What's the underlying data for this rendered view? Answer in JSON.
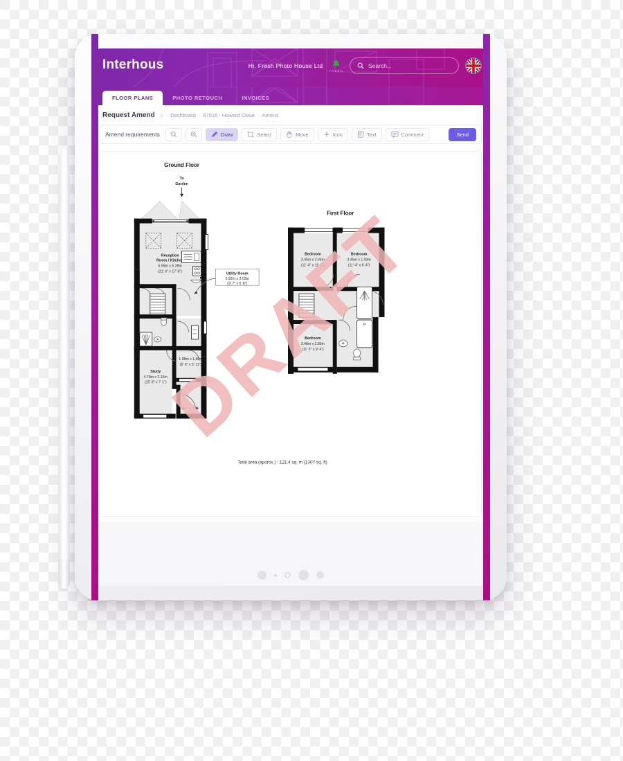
{
  "brand": {
    "name": "Interhous"
  },
  "header": {
    "greeting": "Hi,  Fresh Photo House Ltd",
    "partner_logo_text": "FRESH",
    "search_placeholder": "Search...",
    "flag_label": "uk-flag-icon"
  },
  "tabs": [
    {
      "label": "FLOOR PLANS",
      "active": true
    },
    {
      "label": "PHOTO RETOUCH",
      "active": false
    },
    {
      "label": "INVOICES",
      "active": false
    }
  ],
  "breadcrumb": {
    "title": "Request Amend",
    "home_icon": "⌂",
    "items": [
      "Dashboard",
      "87516 - Howard Close",
      "Amend"
    ],
    "separator": "·"
  },
  "toolbar": {
    "label": "Amend requirements",
    "buttons": [
      {
        "name": "zoom-out",
        "label": "",
        "icon": "zoom-out-icon",
        "active": false
      },
      {
        "name": "zoom-in",
        "label": "",
        "icon": "zoom-in-icon",
        "active": false
      },
      {
        "name": "draw",
        "label": "Draw",
        "icon": "pencil-icon",
        "active": true
      },
      {
        "name": "select",
        "label": "Select",
        "icon": "marquee-icon",
        "active": false
      },
      {
        "name": "move",
        "label": "Move",
        "icon": "hand-icon",
        "active": false
      },
      {
        "name": "icon",
        "label": "Icon",
        "icon": "plus-icon",
        "active": false
      },
      {
        "name": "text",
        "label": "Text",
        "icon": "text-icon",
        "active": false
      },
      {
        "name": "comment",
        "label": "Comment",
        "icon": "comment-icon",
        "active": false
      }
    ],
    "send_label": "Send"
  },
  "floorplan": {
    "watermark": "DRAFT",
    "ground": {
      "title": "Ground Floor",
      "to_garden": "To\nGarden",
      "to_garden_line1": "To",
      "to_garden_line2": "Garden",
      "rooms": [
        {
          "name": "Reception\nRoom / Kitchen",
          "name_line1": "Reception",
          "name_line2": "Room / Kitchen",
          "metric": "6.55m x 5.39m",
          "imperial": "(21' 6\" x 17' 8\")"
        },
        {
          "name": "Utility Room",
          "metric": "2.92m x 2.03m",
          "imperial": "(9' 7\" x 6' 8\")"
        },
        {
          "name": "Study",
          "metric": "4.78m x 2.16m",
          "imperial": "(15' 8\" x 7' 1\")"
        },
        {
          "name": "",
          "metric": "1.98m x 1.80m",
          "imperial": "(6' 6\" x 5' 11\")"
        }
      ]
    },
    "first": {
      "title": "First Floor",
      "rooms": [
        {
          "name": "Bedroom",
          "metric": "3.45m x 3.35m",
          "imperial": "(11' 4\" x 11' 0\")"
        },
        {
          "name": "Bedroom",
          "metric": "3.45m x 1.93m",
          "imperial": "(11' 4\" x 6' 4\")"
        },
        {
          "name": "Bedroom",
          "metric": "3.48m x 2.85m",
          "imperial": "(11' 5\" x 9' 4\")"
        }
      ]
    },
    "total_area": "Total area (aporox.) : 121.4 sq. m (1307 sq. ft)"
  },
  "colors": {
    "brand_purple": "#8a28ae",
    "brand_magenta": "#ab0f86",
    "accent": "#6c5ce7",
    "tool_active_bg": "#d9d5f5",
    "watermark": "#f0b5b5"
  }
}
